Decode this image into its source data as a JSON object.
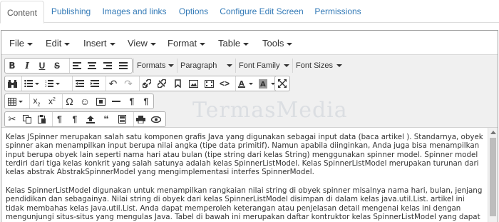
{
  "tabs": [
    "Content",
    "Publishing",
    "Images and links",
    "Options",
    "Configure Edit Screen",
    "Permissions"
  ],
  "menubar": [
    "File",
    "Edit",
    "Insert",
    "View",
    "Format",
    "Table",
    "Tools"
  ],
  "toolbar": {
    "formats": "Formats",
    "paragraph": "Paragraph",
    "font_family": "Font Family",
    "font_sizes": "Font Sizes"
  },
  "watermark": "TermasMedia",
  "content": {
    "p1": "Kelas JSpinner merupakan salah satu komponen grafis Java yang digunakan sebagai input data (baca artikel ). Standarnya, obyek spinner akan menampilkan input berupa nilai angka (tipe data primitif). Namun apabila diinginkan, Anda juga bisa menampilkan input  berupa obyek lain seperti nama hari atau bulan (tipe string dari kelas String) menggunakan spinner model. Spinner model terdiri dari tiga kelas konkrit yang salah satunya adalah kelas SpinnerListModel. Kelas SpinnerListModel merupakan turunan dari kelas abstrak AbstrakSpinnerModel yang mengimplementasi interfes SpinnerModel.",
    "p2": "Kelas SpinnerListModel digunakan untuk menampilkan rangkaian nilai string di obyek spinner misalnya nama hari, bulan, jenjang pendidikan dan sebagainya. Nilai string di obyek dari kelas SpinnerListModel disimpan di dalam kelas java.util.List. artikel ini tidak membahas kelas java.util.List. Anda dapat memperoleh keterangan atau penjelasan detail mengenai kelas ini dengan mengunjungi situs-situs yang mengulas Java. Tabel di bawah ini merupakan daftar kontruktor kelas SpinnerListModel yang dapat digunakan untuk mengkonstruksi obyek SpinnerListModel."
  }
}
